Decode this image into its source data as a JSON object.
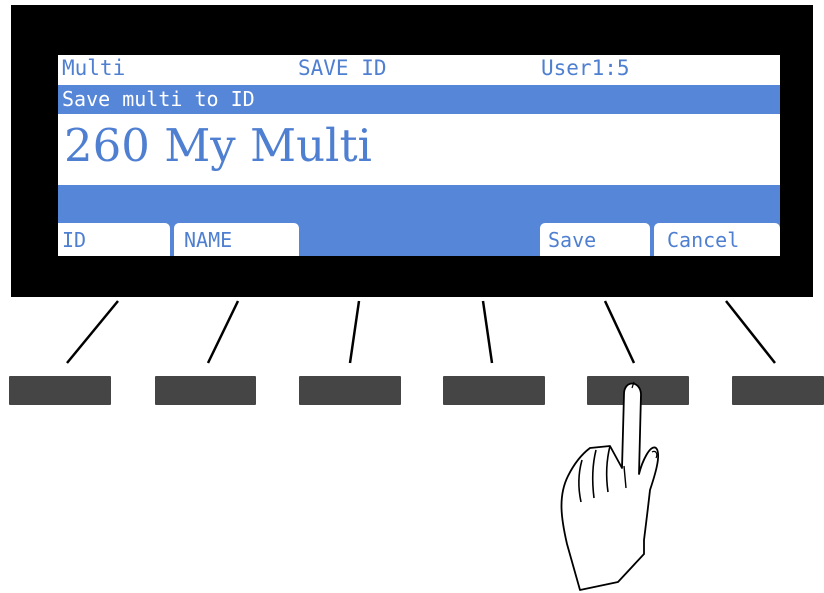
{
  "screen": {
    "header": {
      "mode": "Multi",
      "action": "SAVE ID",
      "bank": "User1:5"
    },
    "subtitle": "Save multi to ID",
    "value": "260 My Multi",
    "soft_buttons": [
      "ID",
      "NAME",
      "Save",
      "Cancel"
    ]
  },
  "hardware_buttons": [
    {
      "label": "soft-button-1"
    },
    {
      "label": "soft-button-2"
    },
    {
      "label": "soft-button-3"
    },
    {
      "label": "soft-button-4"
    },
    {
      "label": "soft-button-5"
    },
    {
      "label": "soft-button-6"
    }
  ],
  "pressed_button": 5,
  "colors": {
    "bezel": "#000000",
    "lcd_text": "#4f7fd1",
    "lcd_band": "#5686d8",
    "hardware_button": "#454545"
  }
}
